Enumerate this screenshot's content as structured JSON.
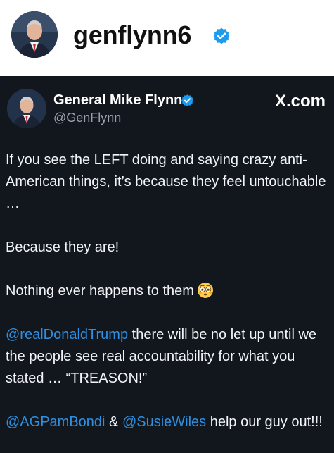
{
  "profile": {
    "username": "genflynn6",
    "avatar_icon": "profile-photo-icon",
    "verified_icon": "verified-badge-icon",
    "verified_color": "#1d9bf0"
  },
  "tweet": {
    "display_name": "General Mike Flynn",
    "handle": "@GenFlynn",
    "brand": "X.com",
    "verified_icon": "verified-badge-icon",
    "background": "#12171e",
    "mention_color": "#2f8fe0",
    "paragraphs": [
      {
        "text": "If you see the LEFT doing and saying crazy anti-American things, it’s because they feel untouchable …"
      },
      {
        "text": "Because they are!"
      },
      {
        "text": "Nothing ever happens to them",
        "emoji": "flushed-face-emoji"
      },
      {
        "mention": "@realDonaldTrump",
        "text": " there will be no let up until we the people see real accountability for what you stated … “TREASON!”"
      },
      {
        "mention1": "@AGPamBondi",
        "middle": " & ",
        "mention2": "@SusieWiles",
        "text": " help our guy out!!!"
      }
    ]
  }
}
